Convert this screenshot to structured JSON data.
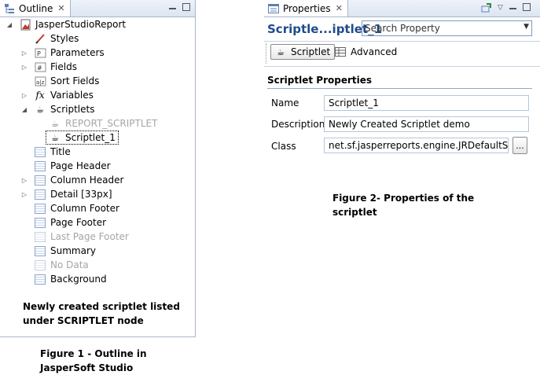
{
  "outline": {
    "tab_label": "Outline",
    "close_glyph": "✕",
    "tree": [
      {
        "id": "root",
        "label": "JasperStudioReport",
        "icon": "report-icon",
        "expander": "expanded",
        "dim": false
      },
      {
        "id": "styles",
        "label": "Styles",
        "icon": "styles-icon",
        "expander": "none",
        "dim": false
      },
      {
        "id": "parameters",
        "label": "Parameters",
        "icon": "parameters-icon",
        "expander": "collapsed",
        "dim": false
      },
      {
        "id": "fields",
        "label": "Fields",
        "icon": "fields-icon",
        "expander": "collapsed",
        "dim": false
      },
      {
        "id": "sort-fields",
        "label": "Sort Fields",
        "icon": "sort-fields-icon",
        "expander": "none",
        "dim": false
      },
      {
        "id": "variables",
        "label": "Variables",
        "icon": "variables-icon",
        "expander": "collapsed",
        "dim": false
      },
      {
        "id": "scriptlets",
        "label": "Scriptlets",
        "icon": "scriptlet-icon",
        "expander": "expanded",
        "dim": false
      },
      {
        "id": "report-scriptlet",
        "label": "REPORT_SCRIPTLET",
        "icon": "scriptlet-icon",
        "expander": "none",
        "dim": true
      },
      {
        "id": "scriptlet-1",
        "label": "Scriptlet_1",
        "icon": "scriptlet-icon",
        "expander": "none",
        "dim": false,
        "selected": true
      },
      {
        "id": "title",
        "label": "Title",
        "icon": "band-icon",
        "expander": "none",
        "dim": false
      },
      {
        "id": "page-header",
        "label": "Page Header",
        "icon": "band-icon",
        "expander": "none",
        "dim": false
      },
      {
        "id": "column-header",
        "label": "Column Header",
        "icon": "band-icon",
        "expander": "collapsed",
        "dim": false
      },
      {
        "id": "detail",
        "label": "Detail [33px]",
        "icon": "band-icon",
        "expander": "collapsed",
        "dim": false
      },
      {
        "id": "column-footer",
        "label": "Column Footer",
        "icon": "band-icon",
        "expander": "none",
        "dim": false
      },
      {
        "id": "page-footer",
        "label": "Page Footer",
        "icon": "band-icon",
        "expander": "none",
        "dim": false
      },
      {
        "id": "last-page-footer",
        "label": "Last Page Footer",
        "icon": "band-icon",
        "expander": "none",
        "dim": true
      },
      {
        "id": "summary",
        "label": "Summary",
        "icon": "band-icon",
        "expander": "none",
        "dim": false
      },
      {
        "id": "no-data",
        "label": "No Data",
        "icon": "band-icon",
        "expander": "none",
        "dim": true
      },
      {
        "id": "background",
        "label": "Background",
        "icon": "band-icon",
        "expander": "none",
        "dim": false
      }
    ],
    "note_line1": "Newly created scriptlet listed",
    "note_line2": "under SCRIPTLET node"
  },
  "figure1": {
    "line1": "Figure 1 - Outline in",
    "line2": "JasperSoft Studio"
  },
  "properties": {
    "tab_label": "Properties",
    "close_glyph": "✕",
    "header_title": "Scriptle...iptlet_1",
    "search_placeholder": "Search Property",
    "tabs": [
      {
        "label": "Scriptlet",
        "icon": "scriptlet-icon",
        "active": true
      },
      {
        "label": "Advanced",
        "icon": "table-icon",
        "active": false
      }
    ],
    "section_title": "Scriptlet Properties",
    "fields": [
      {
        "label": "Name",
        "value": "Scriptlet_1"
      },
      {
        "label": "Description",
        "value": "Newly Created Scriptlet demo"
      },
      {
        "label": "Class",
        "value": "net.sf.jasperreports.engine.JRDefaultScriptlet"
      }
    ],
    "browse_label": "..."
  },
  "figure2": {
    "line1": "Figure 2- Properties of the",
    "line2": "scriptlet"
  },
  "colors": {
    "accent_title": "#1f4b8a",
    "panel_border": "#a9b7c9"
  }
}
